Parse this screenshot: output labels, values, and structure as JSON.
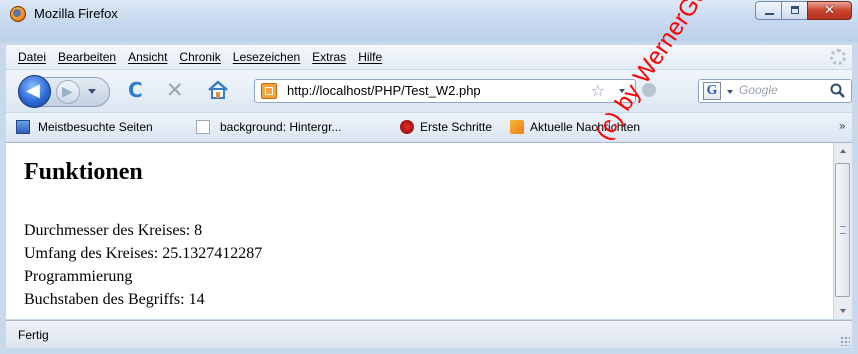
{
  "window": {
    "title": "Mozilla Firefox"
  },
  "menu": [
    "Datei",
    "Bearbeiten",
    "Ansicht",
    "Chronik",
    "Lesezeichen",
    "Extras",
    "Hilfe"
  ],
  "nav": {
    "url": "http://localhost/PHP/Test_W2.php",
    "search_placeholder": "Google"
  },
  "bookmarks": [
    "Meistbesuchte Seiten",
    "background: Hintergr...",
    "Erste Schritte",
    "Aktuelle Nachrichten"
  ],
  "content": {
    "heading": "Funktionen",
    "lines": [
      "Durchmesser des Kreises: 8",
      "Umfang des Kreises: 25.1327412287",
      "Programmierung",
      "Buchstaben des Begriffs: 14"
    ]
  },
  "status": {
    "text": "Fertig"
  },
  "watermark": "(c) by WernerGeers"
}
